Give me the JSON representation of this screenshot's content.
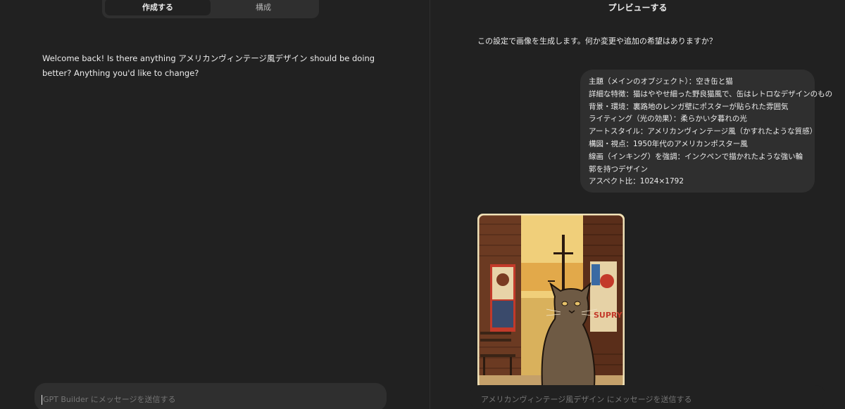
{
  "tabs": [
    {
      "label": "作成する",
      "active": true
    },
    {
      "label": "構成",
      "active": false
    }
  ],
  "builder": {
    "welcome_message": "Welcome back! Is there anything アメリカンヴィンテージ風デザイン should be doing better? Anything you'd like to change?",
    "input_placeholder": "GPT Builder にメッセージを送信する"
  },
  "preview": {
    "title": "プレビューする",
    "assistant_message": "この設定で画像を生成します。何か変更や追加の希望はありますか？",
    "user_message_lines": [
      "主題（メインのオブジェクト）：空き缶と猫",
      "詳細な特徴：猫はややせ細った野良猫風で、缶はレトロなデザインのもの",
      "背景・環境：裏路地のレンガ壁にポスターが貼られた雰囲気",
      "ライティング（光の効果）：柔らかい夕暮れの光",
      "アートスタイル：アメリカンヴィンテージ風（かすれたような質感）",
      "構図・視点：1950年代のアメリカンポスター風",
      "線画（インキング）を強調：インクペンで描かれたような強い輪郭を持つデザイン",
      "アスペクト比：1024×1792"
    ],
    "image_poster_text": "SUPRY",
    "input_placeholder": "アメリカンヴィンテージ風デザイン にメッセージを送信する"
  },
  "colors": {
    "background": "#212121",
    "surface": "#2f2f2f",
    "text": "#ececec",
    "muted": "#9b9b9b"
  }
}
